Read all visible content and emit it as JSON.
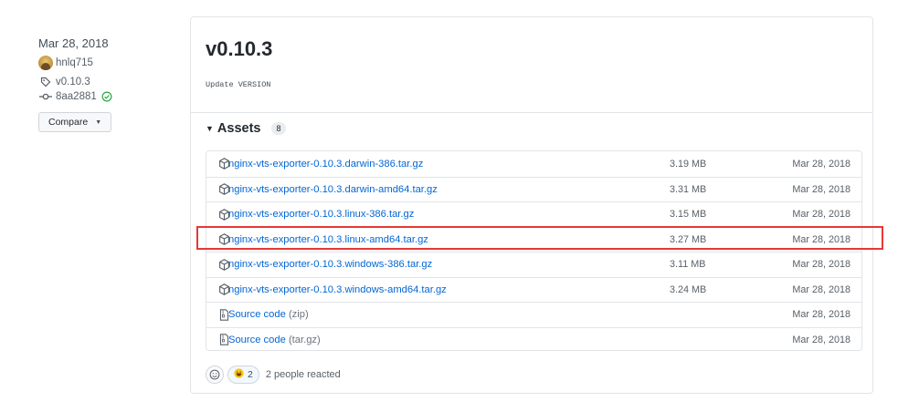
{
  "meta": {
    "date": "Mar 28, 2018",
    "author": "hnlq715",
    "tag": "v0.10.3",
    "commit": "8aa2881",
    "compare_label": "Compare"
  },
  "release": {
    "title": "v0.10.3",
    "description": "Update VERSION",
    "assets_label": "Assets",
    "assets_count": "8",
    "assets": [
      {
        "name": "nginx-vts-exporter-0.10.3.darwin-386.tar.gz",
        "ext": "",
        "size": "3.19 MB",
        "date": "Mar 28, 2018",
        "icon": "package-icon"
      },
      {
        "name": "nginx-vts-exporter-0.10.3.darwin-amd64.tar.gz",
        "ext": "",
        "size": "3.31 MB",
        "date": "Mar 28, 2018",
        "icon": "package-icon"
      },
      {
        "name": "nginx-vts-exporter-0.10.3.linux-386.tar.gz",
        "ext": "",
        "size": "3.15 MB",
        "date": "Mar 28, 2018",
        "icon": "package-icon"
      },
      {
        "name": "nginx-vts-exporter-0.10.3.linux-amd64.tar.gz",
        "ext": "",
        "size": "3.27 MB",
        "date": "Mar 28, 2018",
        "icon": "package-icon"
      },
      {
        "name": "nginx-vts-exporter-0.10.3.windows-386.tar.gz",
        "ext": "",
        "size": "3.11 MB",
        "date": "Mar 28, 2018",
        "icon": "package-icon"
      },
      {
        "name": "nginx-vts-exporter-0.10.3.windows-amd64.tar.gz",
        "ext": "",
        "size": "3.24 MB",
        "date": "Mar 28, 2018",
        "icon": "package-icon"
      },
      {
        "name": "Source code",
        "ext": "(zip)",
        "size": "",
        "date": "Mar 28, 2018",
        "icon": "file-zip-icon"
      },
      {
        "name": "Source code",
        "ext": "(tar.gz)",
        "size": "",
        "date": "Mar 28, 2018",
        "icon": "file-zip-icon"
      }
    ],
    "reactions": {
      "count": "2",
      "text": "2 people reacted"
    }
  },
  "colors": {
    "link": "#0366d6",
    "highlight": "#e53935",
    "success": "#28a745"
  }
}
